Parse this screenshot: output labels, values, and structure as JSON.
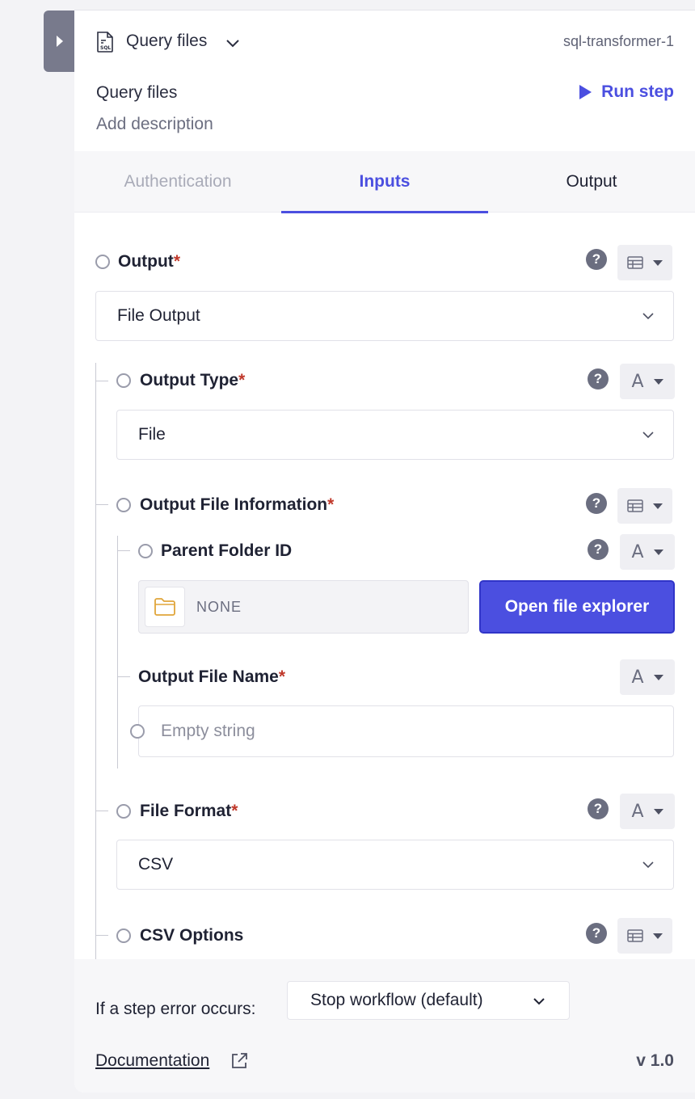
{
  "header": {
    "step_name": "Query files",
    "step_id": "sql-transformer-1",
    "title": "Query files",
    "description_placeholder": "Add description",
    "run_label": "Run step"
  },
  "tabs": [
    {
      "label": "Authentication",
      "state": "disabled"
    },
    {
      "label": "Inputs",
      "state": "active"
    },
    {
      "label": "Output",
      "state": "normal"
    }
  ],
  "fields": {
    "output": {
      "label": "Output",
      "required": "*",
      "value": "File Output"
    },
    "output_type": {
      "label": "Output Type",
      "required": "*",
      "value": "File"
    },
    "output_file_info": {
      "label": "Output File Information",
      "required": "*"
    },
    "parent_folder": {
      "label": "Parent Folder ID",
      "value": "NONE",
      "button_label": "Open file explorer"
    },
    "output_file_name": {
      "label": "Output File Name",
      "required": "*",
      "placeholder": "Empty string"
    },
    "file_format": {
      "label": "File Format",
      "required": "*",
      "value": "CSV"
    },
    "csv_options": {
      "label": "CSV Options"
    }
  },
  "help_glyph": "?",
  "text_type_glyph": "A",
  "footer": {
    "error_label": "If a step error occurs:",
    "error_value": "Stop workflow (default)",
    "doc_label": "Documentation",
    "version": "v 1.0"
  },
  "colors": {
    "accent": "#4b4fe0",
    "required": "#c0392b",
    "folder": "#e0a53a"
  }
}
